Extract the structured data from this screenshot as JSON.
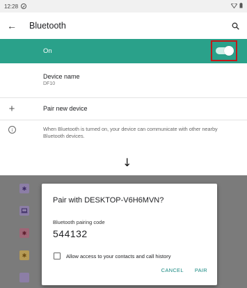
{
  "statusbar": {
    "time": "12:28"
  },
  "appbar": {
    "title": "Bluetooth"
  },
  "bluetooth_toggle": {
    "label": "On",
    "state": "on",
    "accent": "#2aa18a"
  },
  "device_name": {
    "title": "Device name",
    "value": "DF10"
  },
  "pair_new": {
    "label": "Pair new device"
  },
  "info": {
    "text": "When Bluetooth is turned on, your device can communicate with other nearby Bluetooth devices."
  },
  "dialog": {
    "title": "Pair with DESKTOP-V6H6MVN?",
    "code_label": "Bluetooth pairing code",
    "code": "544132",
    "checkbox_label": "Allow access to your contacts and call history",
    "cancel": "CANCEL",
    "pair": "PAIR",
    "accent": "#1a8a83"
  },
  "icons": [
    "dnd-icon",
    "wifi-icon",
    "battery-icon",
    "back-arrow-icon",
    "search-icon",
    "plus-icon",
    "info-icon",
    "down-arrow-icon"
  ]
}
